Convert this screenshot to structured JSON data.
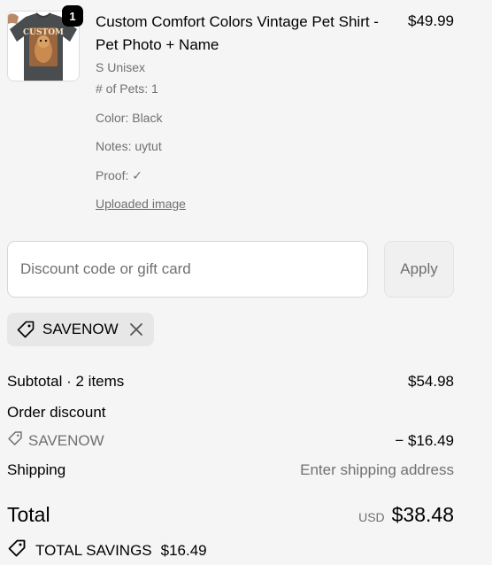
{
  "cart": {
    "item": {
      "quantity": "1",
      "title": "Custom Comfort Colors Vintage Pet Shirt - Pet Photo + Name",
      "variant": "S Unisex",
      "properties": {
        "pets": "# of Pets: 1",
        "color": "Color: Black",
        "notes": "Notes: uytut",
        "proof": "Proof: ✓"
      },
      "uploaded_link": "Uploaded image",
      "price": "$49.99",
      "thumbnail_text": "CUSTOM"
    }
  },
  "discount": {
    "placeholder": "Discount code or gift card",
    "apply_label": "Apply",
    "applied_code": "SAVENOW"
  },
  "summary": {
    "subtotal_label": "Subtotal · 2 items",
    "subtotal_value": "$54.98",
    "order_discount_label": "Order discount",
    "discount_code": "SAVENOW",
    "discount_value": "− $16.49",
    "shipping_label": "Shipping",
    "shipping_value": "Enter shipping address",
    "total_label": "Total",
    "currency": "USD",
    "total_value": "$38.48",
    "savings_label": "TOTAL SAVINGS",
    "savings_value": "$16.49"
  },
  "colors": {
    "background": "#f5f5f5",
    "muted_text": "#707070",
    "badge": "#000000",
    "shirt": "#4a4d4f"
  }
}
